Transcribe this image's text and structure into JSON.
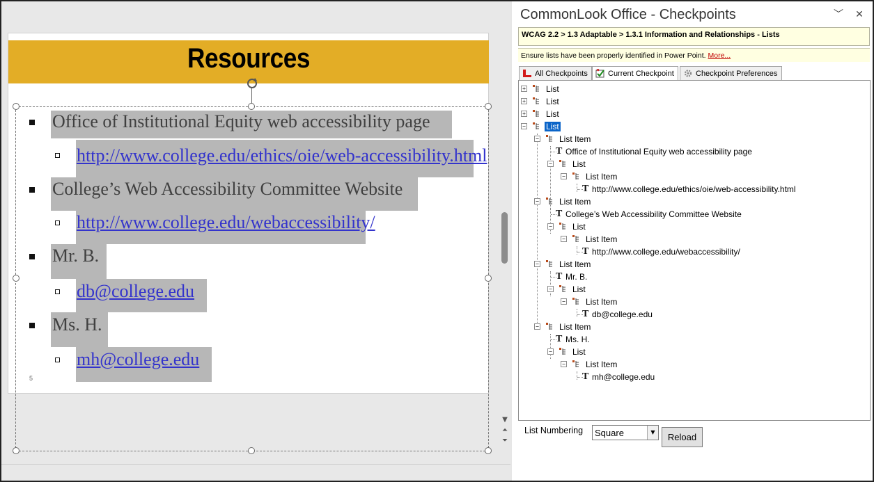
{
  "slide": {
    "title": "Resources",
    "slide_number": "5",
    "bullets": [
      {
        "text": "Office of Institutional Equity web accessibility page",
        "link": "http://www.college.edu/ethics/oie/web-accessibility.html"
      },
      {
        "text": "College’s Web Accessibility Committee Website",
        "link": "http://www.college.edu/webaccessibility/"
      },
      {
        "text": "Mr. B.",
        "link": "db@college.edu"
      },
      {
        "text": "Ms. H.",
        "link": "mh@college.edu"
      }
    ]
  },
  "pane": {
    "title": "CommonLook Office - Checkpoints",
    "breadcrumb": "WCAG 2.2 > 1.3 Adaptable > 1.3.1 Information and Relationships - Lists",
    "description": "Ensure lists have been properly identified in Power Point.",
    "more_link": "More...",
    "tabs": [
      "All Checkpoints",
      "Current Checkpoint",
      "Checkpoint Preferences"
    ],
    "tree": [
      "List",
      "List",
      "List",
      "List",
      "List Item",
      "Office of Institutional Equity web accessibility page",
      "List",
      "List Item",
      "http://www.college.edu/ethics/oie/web-accessibility.html",
      "List Item",
      "College’s Web Accessibility Committee Website",
      "List",
      "List Item",
      "http://www.college.edu/webaccessibility/",
      "List Item",
      "Mr. B.",
      "List",
      "List Item",
      "db@college.edu",
      "List Item",
      "Ms. H.",
      "List",
      "List Item",
      "mh@college.edu"
    ],
    "list_numbering_label": "List Numbering",
    "list_numbering_value": "Square",
    "reload_label": "Reload"
  },
  "colors": {
    "title_bar": "#e3ad26",
    "highlight": "#b7b7b7",
    "link": "#3333cc",
    "tree_selection": "#0a64c8",
    "more_link": "#c00000"
  }
}
